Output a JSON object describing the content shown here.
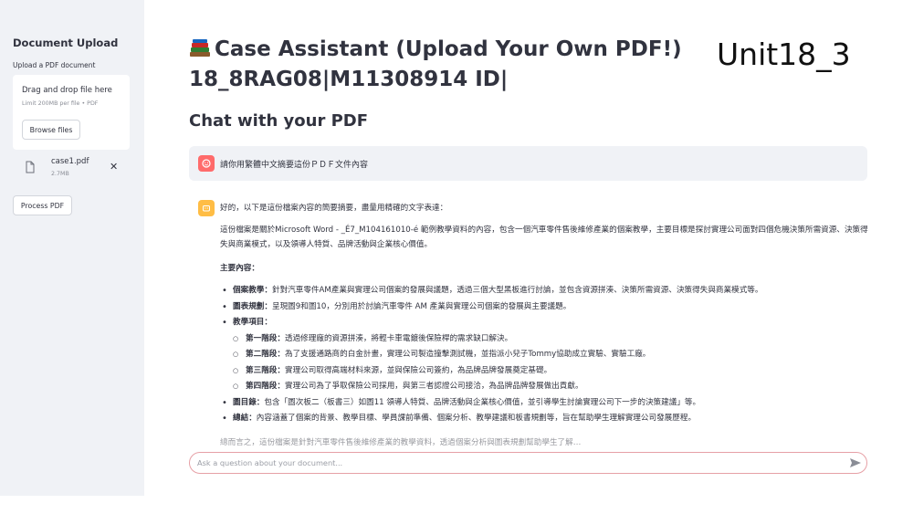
{
  "sidebar": {
    "title": "Document Upload",
    "upload_label": "Upload a PDF document",
    "dropzone_title": "Drag and drop file here",
    "dropzone_limit": "Limit 200MB per file • PDF",
    "browse_label": "Browse files",
    "file_name": "case1.pdf",
    "file_size": "2.7MB",
    "process_label": "Process PDF"
  },
  "header": {
    "title_line1": "Case Assistant (Upload Your Own PDF!)",
    "title_line2": "18_8RAG08|M11308914 ID|",
    "unit_label": "Unit18_3",
    "chat_heading": "Chat with your PDF"
  },
  "chat": {
    "user_message": "請你用繁體中文摘要這份ＰＤＦ文件內容",
    "bot_intro": "好的，以下是這份檔案內容的簡要摘要，盡量用精確的文字表達：",
    "bot_paragraph": "這份檔案是關於Microsoft Word - _É7_M104161010-é 範例教學資料的內容，包含一個汽車零件售後維修產業的個案教學，主要目標是探討實理公司面對四個危機決策所需資源、決策得失與商業模式，以及領導人特質、品牌活動與企業核心價值。",
    "section_title": "主要內容：",
    "items": [
      {
        "label": "個案教學：",
        "text": "針對汽車零件AM產業與實理公司個案的發展與議題，透過三個大型黑板進行討論，並包含資源拼湊、決策所需資源、決策得失與商業模式等。"
      },
      {
        "label": "圖表規劃：",
        "text": "呈現圖9和圖10，分別用於討論汽車零件 AM 產業與實理公司個案的發展與主要議題。"
      },
      {
        "label": "教學項目：",
        "text": ""
      }
    ],
    "sub_items": [
      {
        "label": "第一階段：",
        "text": "透過修理廠的資源拼湊，將輕卡車電鍍後保險桿的需求缺口解決。"
      },
      {
        "label": "第二階段：",
        "text": "為了支援通路商的白金計畫，實理公司製造撞擊測試機，並指派小兒子Tommy協助成立實驗、實驗工廠。"
      },
      {
        "label": "第三階段：",
        "text": "實理公司取得高端材料來源，並與保險公司簽約，為品牌品牌發展奠定基礎。"
      },
      {
        "label": "第四階段：",
        "text": "實理公司為了爭取保險公司採用，與第三者認證公司接洽，為品牌品牌發展做出貢獻。"
      }
    ],
    "tail_items": [
      {
        "label": "圖目錄：",
        "text": "包含「圖次板二（板書三）如圖11 領導人特質、品牌活動與企業核心價值，並引導學生討論實理公司下一步的決策建議」等。"
      },
      {
        "label": "總結：",
        "text": "內容涵蓋了個案的背景、教學目標、學員課前準備、個案分析、教學建議和板書規劃等，旨在幫助學生理解實理公司發展歷程。"
      }
    ],
    "faded_line": "總而言之，這份檔案是針對汽車零件售後維修產業的教學資料，透過個案分析與圖表規劃幫助學生了解…",
    "input_placeholder": "Ask a question about your document..."
  },
  "colors": {
    "sidebar_bg": "#f0f2f6",
    "user_avatar": "#ff6b6b",
    "bot_avatar": "#ffbd45",
    "input_border": "#e6a0a6"
  },
  "icons": {
    "title_emoji": "books-icon",
    "file": "file-icon",
    "close": "close-icon",
    "user_avatar": "user-avatar-icon",
    "bot_avatar": "bot-avatar-icon",
    "send": "send-icon"
  }
}
